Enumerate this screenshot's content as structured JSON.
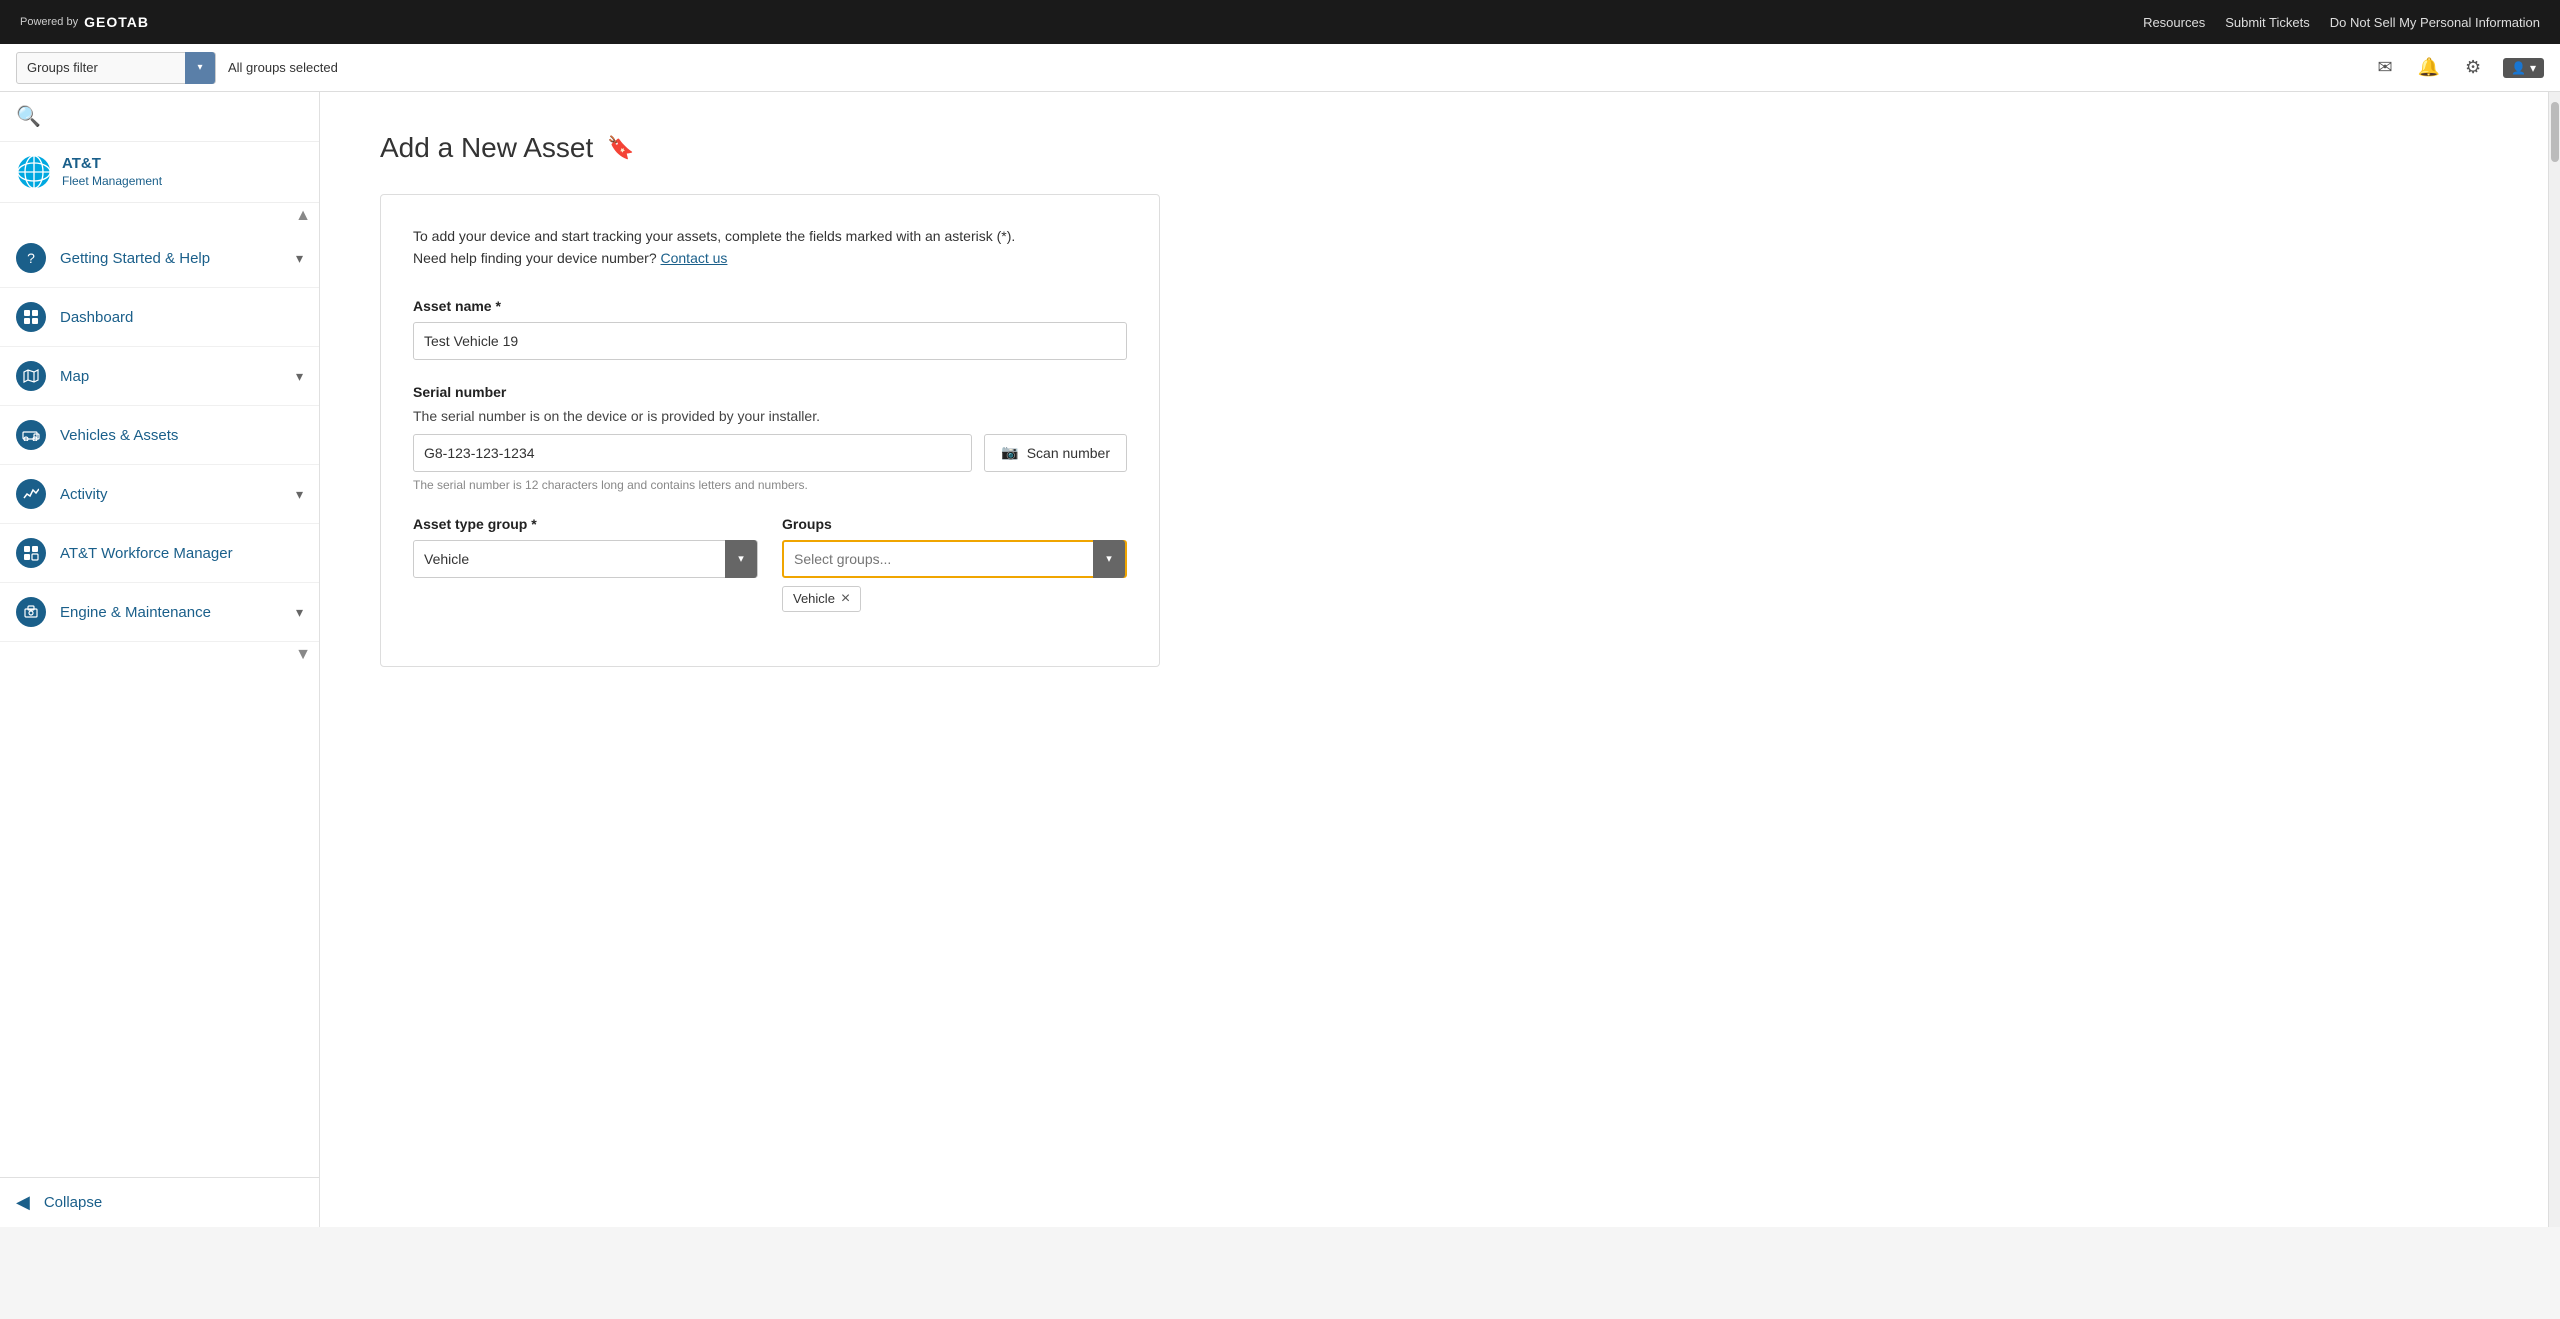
{
  "topnav": {
    "brand": "Powered by",
    "logo": "GEOTAB",
    "links": [
      "Resources",
      "Submit Tickets",
      "Do Not Sell My Personal Information"
    ]
  },
  "filterbar": {
    "label": "Groups filter",
    "selected": "All groups selected",
    "icons": {
      "mail": "✉",
      "bell": "🔔",
      "gear": "⚙",
      "user": "👤"
    }
  },
  "sidebar": {
    "brand_name": "AT&T",
    "brand_sub": "Fleet Management",
    "nav_items": [
      {
        "id": "getting-started",
        "label": "Getting Started & Help",
        "icon": "?"
      },
      {
        "id": "dashboard",
        "label": "Dashboard",
        "icon": "📊"
      },
      {
        "id": "map",
        "label": "Map",
        "icon": "🗺"
      },
      {
        "id": "vehicles",
        "label": "Vehicles & Assets",
        "icon": "🚚"
      },
      {
        "id": "activity",
        "label": "Activity",
        "icon": "📈"
      },
      {
        "id": "workforce",
        "label": "AT&T Workforce Manager",
        "icon": "🧩"
      },
      {
        "id": "engine",
        "label": "Engine & Maintenance",
        "icon": "🎬"
      }
    ],
    "collapse_label": "Collapse"
  },
  "page": {
    "title": "Add a New Asset",
    "intro_line1": "To add your device and start tracking your assets, complete the fields marked with an asterisk (*).",
    "intro_line2": "Need help finding your device number?",
    "contact_link": "Contact us",
    "asset_name_label": "Asset name *",
    "asset_name_value": "Test Vehicle 19",
    "serial_number_label": "Serial number",
    "serial_number_hint1": "The serial number is on the device or is provided by your installer.",
    "serial_number_value": "G8-123-123-1234",
    "serial_number_hint2": "The serial number is 12 characters long and contains letters and numbers.",
    "scan_button_label": "Scan number",
    "scan_icon": "📷",
    "asset_type_label": "Asset type group *",
    "asset_type_value": "Vehicle",
    "groups_label": "Groups",
    "groups_placeholder": "Select groups...",
    "tag_vehicle": "Vehicle",
    "tag_close": "×"
  }
}
